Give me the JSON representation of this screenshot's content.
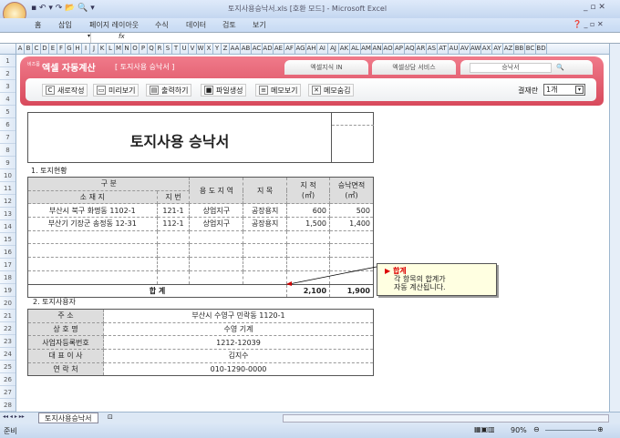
{
  "window": {
    "title": "토지사용승낙서.xls  [호환 모드]  -  Microsoft Excel"
  },
  "ribbon_tabs": [
    "홈",
    "삽입",
    "페이지 레이아웃",
    "수식",
    "데이터",
    "검토",
    "보기"
  ],
  "formula_bar": {
    "fx": "fx"
  },
  "columns": [
    "A",
    "B",
    "C",
    "D",
    "E",
    "F",
    "G",
    "H",
    "I",
    "J",
    "K",
    "L",
    "M",
    "N",
    "O",
    "P",
    "Q",
    "R",
    "S",
    "T",
    "U",
    "V",
    "W",
    "X",
    "Y",
    "Z",
    "AA",
    "AB",
    "AC",
    "AD",
    "AE",
    "AF",
    "AG",
    "AH",
    "AI",
    "AJ",
    "AK",
    "AL",
    "AM",
    "AN",
    "AO",
    "AP",
    "AQ",
    "AR",
    "AS",
    "AT",
    "AU",
    "AV",
    "AW",
    "AX",
    "AY",
    "AZ",
    "BB",
    "BC",
    "BD"
  ],
  "rows": [
    "1",
    "2",
    "3",
    "4",
    "5",
    "6",
    "7",
    "8",
    "9",
    "10",
    "11",
    "12",
    "13",
    "14",
    "15",
    "16",
    "17",
    "18",
    "19",
    "20",
    "21",
    "22",
    "23",
    "24",
    "25",
    "26",
    "27",
    "28"
  ],
  "banner": {
    "brand_small": "비즈폼",
    "brand": "엑셀 자동계산",
    "doc_title": "[ 토지사용 승낙서 ]",
    "tab1": "엑셀지식 IN",
    "tab2": "엑셀상담 서비스",
    "search_value": "승낙서",
    "buttons": [
      "새로작성",
      "미리보기",
      "출력하기",
      "파일생성",
      "메모보기",
      "메모숨김"
    ],
    "approval_label": "결재란",
    "approval_value": "1개"
  },
  "doc": {
    "title": "토지사용 승낙서",
    "section1": "1. 토지현황",
    "section2": "2. 토지사용자",
    "headers": {
      "gubun": "구          분",
      "location": "소  재  지",
      "lot": "지  번",
      "zone": "용 도 지 역",
      "category": "지     목",
      "area": "지     적",
      "area_unit": "(㎡)",
      "approved": "승낙면적",
      "approved_unit": "(㎡)"
    },
    "land": [
      {
        "location": "부산시 북구 화명동 1102-1",
        "lot": "121-1",
        "zone": "상업지구",
        "category": "공장용지",
        "area": "600",
        "approved": "500"
      },
      {
        "location": "부산기 기장군 송정동 12-31",
        "lot": "112-1",
        "zone": "상업지구",
        "category": "공장용지",
        "area": "1,500",
        "approved": "1,400"
      },
      {
        "location": "",
        "lot": "",
        "zone": "",
        "category": "",
        "area": "",
        "approved": ""
      },
      {
        "location": "",
        "lot": "",
        "zone": "",
        "category": "",
        "area": "",
        "approved": ""
      },
      {
        "location": "",
        "lot": "",
        "zone": "",
        "category": "",
        "area": "",
        "approved": ""
      },
      {
        "location": "",
        "lot": "",
        "zone": "",
        "category": "",
        "area": "",
        "approved": ""
      }
    ],
    "total_label": "합          계",
    "total_area": "2,100",
    "total_approved": "1,900",
    "user": [
      {
        "label": "주          소",
        "value": "부산시 수영구 민락동 1120-1"
      },
      {
        "label": "상   호   명",
        "value": "수영 기계"
      },
      {
        "label": "사업자등록번호",
        "value": "1212-12039"
      },
      {
        "label": "대 표 이 사",
        "value": "김지수"
      },
      {
        "label": "연   락   처",
        "value": "010-1290-0000"
      }
    ]
  },
  "memo": {
    "title": "합계",
    "line1": "각 항목의 합계가",
    "line2": "자동 계산됩니다."
  },
  "sheet_tab": "토지사용승낙서",
  "status": {
    "ready": "준비",
    "zoom": "90%"
  }
}
